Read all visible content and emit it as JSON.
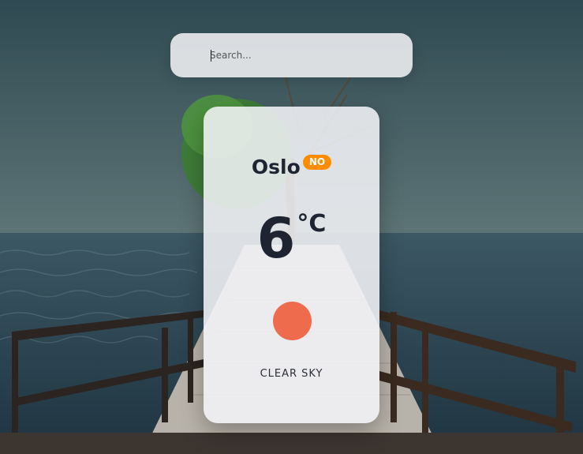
{
  "search": {
    "placeholder": "Search..."
  },
  "weather": {
    "city": "Oslo",
    "country_code": "NO",
    "temperature": "6",
    "unit": "°C",
    "description": "CLEAR SKY",
    "icon": "sun-icon"
  },
  "colors": {
    "badge": "#ff8c00",
    "sun": "#ee6c4d",
    "text": "#1f2433"
  }
}
